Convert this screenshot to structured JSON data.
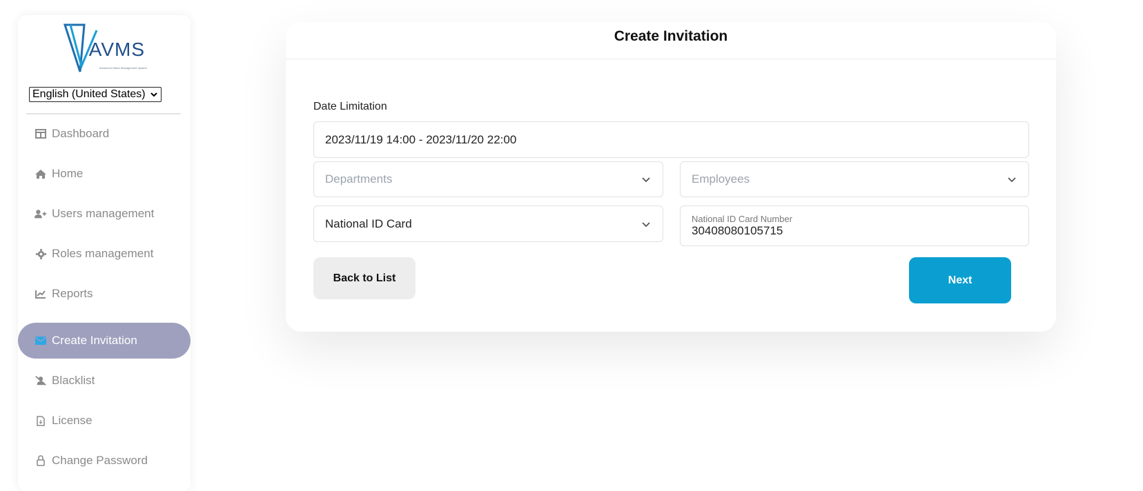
{
  "sidebar": {
    "logo_text": "AVMS",
    "logo_subtitle": "Advanced Visitor Management System",
    "language": "English (United States)",
    "items": [
      {
        "label": "Dashboard",
        "icon": "dashboard-icon"
      },
      {
        "label": "Home",
        "icon": "home-icon"
      },
      {
        "label": "Users management",
        "icon": "user-plus-icon"
      },
      {
        "label": "Roles management",
        "icon": "gear-icon"
      },
      {
        "label": "Reports",
        "icon": "chart-line-icon"
      },
      {
        "label": "Create Invitation",
        "icon": "envelope-icon",
        "active": true
      },
      {
        "label": "Blacklist",
        "icon": "user-slash-icon"
      },
      {
        "label": "License",
        "icon": "file-icon"
      },
      {
        "label": "Change Password",
        "icon": "lock-icon"
      }
    ]
  },
  "card": {
    "title": "Create Invitation",
    "date_label": "Date Limitation",
    "date_value": "2023/11/19 14:00 - 2023/11/20 22:00",
    "departments_placeholder": "Departments",
    "employees_placeholder": "Employees",
    "id_type": "National ID Card",
    "id_number_label": "National ID Card Number",
    "id_number_value": "30408080105715",
    "back_label": "Back to List",
    "next_label": "Next"
  },
  "colors": {
    "accent": "#0a9fd0",
    "active_nav": "#9ea0bd",
    "logo": "#1f4e8c"
  }
}
